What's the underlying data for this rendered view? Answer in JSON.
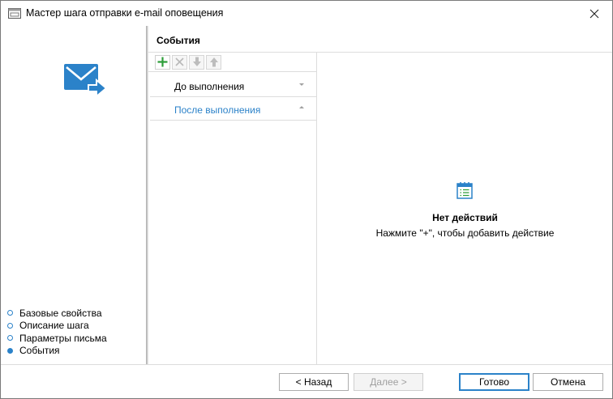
{
  "window": {
    "title": "Мастер шага отправки e-mail оповещения",
    "icon": "window-icon",
    "close_icon": "close-icon"
  },
  "sidebar": {
    "icon": "mail-send-icon",
    "steps": [
      {
        "label": "Базовые свойства",
        "active": false
      },
      {
        "label": "Описание шага",
        "active": false
      },
      {
        "label": "Параметры письма",
        "active": false
      },
      {
        "label": "События",
        "active": true
      }
    ]
  },
  "section": {
    "title": "События"
  },
  "toolbar": {
    "buttons": [
      {
        "icon": "add-icon",
        "enabled": true
      },
      {
        "icon": "delete-icon",
        "enabled": false
      },
      {
        "icon": "move-down-icon",
        "enabled": false
      },
      {
        "icon": "move-up-icon",
        "enabled": false
      }
    ]
  },
  "events": [
    {
      "label": "До выполнения",
      "selected": false,
      "expanded": false
    },
    {
      "label": "После выполнения",
      "selected": true,
      "expanded": true
    }
  ],
  "empty_state": {
    "icon": "calendar-list-icon",
    "title": "Нет действий",
    "hint": "Нажмите \"+\", чтобы добавить действие"
  },
  "footer": {
    "back_label": "< Назад",
    "next_label": "Далее >",
    "done_label": "Готово",
    "cancel_label": "Отмена"
  },
  "colors": {
    "accent": "#2b82c9",
    "add_green": "#2e9e3a"
  }
}
